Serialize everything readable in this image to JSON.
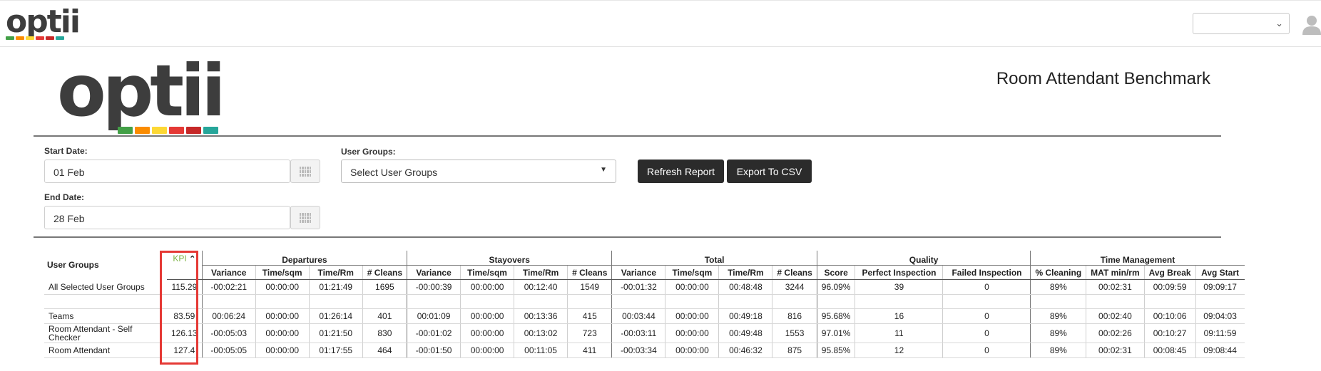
{
  "header": {
    "logo_text": "optii",
    "logo_colors": [
      "#43a047",
      "#fb8c00",
      "#fdd835",
      "#e53935",
      "#c62828",
      "#26a69a"
    ],
    "select_value": "",
    "user_icon": "user-icon"
  },
  "report": {
    "logo_text": "optii",
    "title": "Room Attendant Benchmark"
  },
  "filters": {
    "start_label": "Start Date:",
    "start_value": "01 Feb",
    "end_label": "End Date:",
    "end_value": "28 Feb",
    "groups_label": "User Groups:",
    "groups_value": "Select User Groups",
    "refresh_label": "Refresh Report",
    "export_label": "Export To CSV"
  },
  "table": {
    "col_user_groups": "User Groups",
    "col_kpi": "KPI",
    "groups": [
      "Departures",
      "Stayovers",
      "Total",
      "Quality",
      "Time Management"
    ],
    "sub_cols": [
      "Variance",
      "Time/sqm",
      "Time/Rm",
      "# Cleans",
      "Variance",
      "Time/sqm",
      "Time/Rm",
      "# Cleans",
      "Variance",
      "Time/sqm",
      "Time/Rm",
      "# Cleans",
      "Score",
      "Perfect Inspection",
      "Failed Inspection",
      "% Cleaning",
      "MAT min/rm",
      "Avg Break",
      "Avg Start"
    ],
    "summary": {
      "name": "All Selected User Groups",
      "kpi": "115.29",
      "cells": [
        "-00:02:21",
        "00:00:00",
        "01:21:49",
        "1695",
        "-00:00:39",
        "00:00:00",
        "00:12:40",
        "1549",
        "-00:01:32",
        "00:00:00",
        "00:48:48",
        "3244",
        "96.09%",
        "39",
        "0",
        "89%",
        "00:02:31",
        "00:09:59",
        "09:09:17"
      ]
    },
    "rows": [
      {
        "name": "Teams",
        "kpi": "83.59",
        "cells": [
          "00:06:24",
          "00:00:00",
          "01:26:14",
          "401",
          "00:01:09",
          "00:00:00",
          "00:13:36",
          "415",
          "00:03:44",
          "00:00:00",
          "00:49:18",
          "816",
          "95.68%",
          "16",
          "0",
          "89%",
          "00:02:40",
          "00:10:06",
          "09:04:03"
        ]
      },
      {
        "name": "Room Attendant - Self Checker",
        "kpi": "126.13",
        "cells": [
          "-00:05:03",
          "00:00:00",
          "01:21:50",
          "830",
          "-00:01:02",
          "00:00:00",
          "00:13:02",
          "723",
          "-00:03:11",
          "00:00:00",
          "00:49:48",
          "1553",
          "97.01%",
          "11",
          "0",
          "89%",
          "00:02:26",
          "00:10:27",
          "09:11:59"
        ]
      },
      {
        "name": "Room Attendant",
        "kpi": "127.4",
        "cells": [
          "-00:05:05",
          "00:00:00",
          "01:17:55",
          "464",
          "-00:01:50",
          "00:00:00",
          "00:11:05",
          "411",
          "-00:03:34",
          "00:00:00",
          "00:46:32",
          "875",
          "95.85%",
          "12",
          "0",
          "89%",
          "00:02:31",
          "00:08:45",
          "09:08:44"
        ]
      }
    ]
  }
}
